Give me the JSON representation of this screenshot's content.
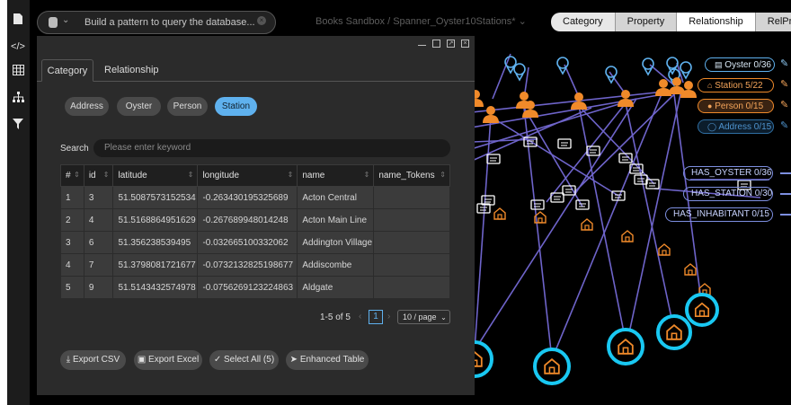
{
  "header": {
    "search_placeholder": "Build a pattern to query the database...",
    "doc_title": "Books Sandbox / Spanner_Oyster10Stations*"
  },
  "top_tabs": [
    {
      "label": "Category",
      "active": false
    },
    {
      "label": "Property",
      "active": false
    },
    {
      "label": "Relationship",
      "active": true
    },
    {
      "label": "RelProperty",
      "active": false
    }
  ],
  "panel": {
    "tabs": [
      {
        "label": "Category",
        "active": true
      },
      {
        "label": "Relationship",
        "active": false
      }
    ],
    "category_pills": [
      {
        "label": "Address",
        "active": false
      },
      {
        "label": "Oyster",
        "active": false
      },
      {
        "label": "Person",
        "active": false
      },
      {
        "label": "Station",
        "active": true
      }
    ],
    "search_label": "Search",
    "search_placeholder": "Please enter keyword",
    "table": {
      "columns": [
        "#",
        "id",
        "latitude",
        "longitude",
        "name",
        "name_Tokens"
      ],
      "rows": [
        [
          "1",
          "3",
          "51.5087573152534",
          "-0.263430195325689",
          "Acton Central",
          ""
        ],
        [
          "2",
          "4",
          "51.5168864951629",
          "-0.267689948014248",
          "Acton Main Line",
          ""
        ],
        [
          "3",
          "6",
          "51.356238539495",
          "-0.032665100332062",
          "Addington Village",
          ""
        ],
        [
          "4",
          "7",
          "51.3798081721677",
          "-0.0732132825198677",
          "Addiscombe",
          ""
        ],
        [
          "5",
          "9",
          "51.5143432574978",
          "-0.0756269123224863",
          "Aldgate",
          ""
        ]
      ]
    },
    "pagination": {
      "range": "1-5 of 5",
      "current_page": "1",
      "page_size": "10 / page"
    },
    "buttons": {
      "export_csv": "Export CSV",
      "export_excel": "Export Excel",
      "select_all": "Select All (5)",
      "enhanced_table": "Enhanced Table"
    }
  },
  "legend": {
    "categories": [
      {
        "label": "Oyster 0/36",
        "color": "#5fb1ee",
        "icon": "card-icon"
      },
      {
        "label": "Station 5/22",
        "color": "#f08a2a",
        "icon": "station-icon"
      },
      {
        "label": "Person 0/15",
        "color": "#f08a2a",
        "icon": "person-icon"
      },
      {
        "label": "Address 0/15",
        "color": "#2f6fa3",
        "icon": "pin-icon"
      }
    ],
    "relationships": [
      {
        "label": "HAS_OYSTER 0/36",
        "color": "#7d8fe0"
      },
      {
        "label": "HAS_STATION 0/30",
        "color": "#7d8fe0"
      },
      {
        "label": "HAS_INHABITANT 0/15",
        "color": "#7d8fe0"
      }
    ]
  },
  "colors": {
    "accent_blue": "#5fb1ee",
    "person_orange": "#f08a2a",
    "edge_purple": "#7b6fe0",
    "selected_glow": "#19c8f2"
  }
}
